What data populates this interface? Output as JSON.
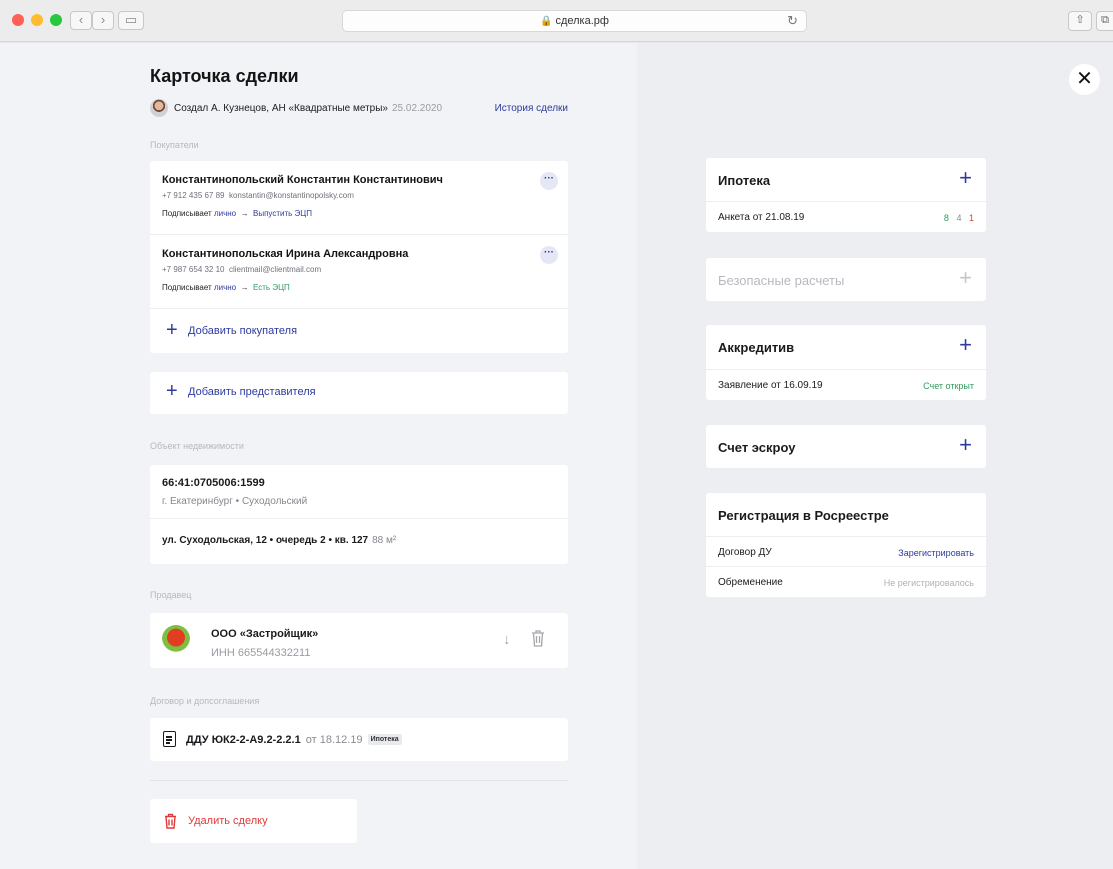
{
  "browser": {
    "url": "сделка.рф"
  },
  "deal": {
    "title": "Карточка сделки",
    "created_by": "Создал А. Кузнецов, АН «Квадратные метры»",
    "created_date": "25.02.2020",
    "history_link": "История сделки"
  },
  "buyers": {
    "label": "Покупатели",
    "items": [
      {
        "name": "Константинопольский Константин Константинович",
        "phone": "+7 912 435 67 89",
        "email": "konstantin@konstantinopolsky.com",
        "sign_prefix": "Подписывает",
        "sign_mode": "лично",
        "arrow": "→",
        "sign_status": "Выпустить ЭЦП"
      },
      {
        "name": "Константинопольская Ирина Александровна",
        "phone": "+7 987 654 32 10",
        "email": "clientmail@clientmail.com",
        "sign_prefix": "Подписывает",
        "sign_mode": "лично",
        "arrow": "→",
        "sign_status": "Есть ЭЦП"
      }
    ],
    "add_buyer": "Добавить покупателя",
    "add_representative": "Добавить представителя"
  },
  "property": {
    "label": "Объект недвижимости",
    "cadastral": "66:41:0705006:1599",
    "city": "г. Екатеринбург • Суходольский",
    "address": "ул. Суходольская, 12 • очередь 2 • кв. 127",
    "area": "88 м²"
  },
  "seller": {
    "label": "Продавец",
    "name": "ООО «Застройщик»",
    "inn": "ИНН 665544332211"
  },
  "contract": {
    "label": "Договор и допсоглашения",
    "name": "ДДУ ЮК2-2-А9.2-2.2.1",
    "date": "от 18.12.19",
    "tag": "Ипотека"
  },
  "delete_deal": "Удалить сделку",
  "right": {
    "mortgage": {
      "title": "Ипотека",
      "row_label": "Анкета от 21.08.19",
      "counts": [
        "8",
        "4",
        "1"
      ]
    },
    "safe_payments": {
      "title": "Безопасные расчеты"
    },
    "letter_of_credit": {
      "title": "Аккредитив",
      "row_label": "Заявление от 16.09.19",
      "row_status": "Счет открыт"
    },
    "escrow": {
      "title": "Счет эскроу"
    },
    "registration": {
      "title": "Регистрация в Росреестре",
      "rows": [
        {
          "label": "Договор ДУ",
          "value": "Зарегистрировать"
        },
        {
          "label": "Обременение",
          "value": "Не регистрировалось"
        }
      ]
    }
  },
  "colors": {
    "accent": "#2d3a9e",
    "success": "#2e9c5c",
    "danger": "#e03a3a"
  }
}
